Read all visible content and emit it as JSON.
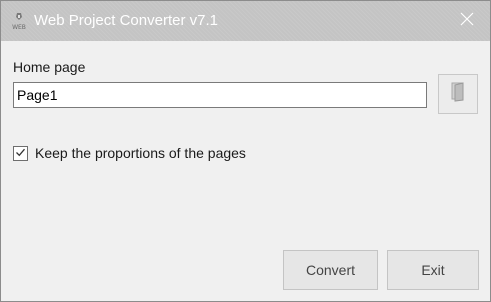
{
  "window": {
    "title": "Web Project Converter v7.1",
    "app_icon": "web-app-icon",
    "close_icon": "close-icon"
  },
  "form": {
    "home_page_label": "Home page",
    "home_page_value": "Page1",
    "browse_icon": "folder-icon",
    "keep_proportions_label": "Keep the proportions of the pages",
    "keep_proportions_checked": true
  },
  "buttons": {
    "convert_label": "Convert",
    "exit_label": "Exit"
  },
  "colors": {
    "titlebar": "#c4c4c4",
    "background": "#f0f0f0",
    "input_border": "#7a7a7a"
  }
}
